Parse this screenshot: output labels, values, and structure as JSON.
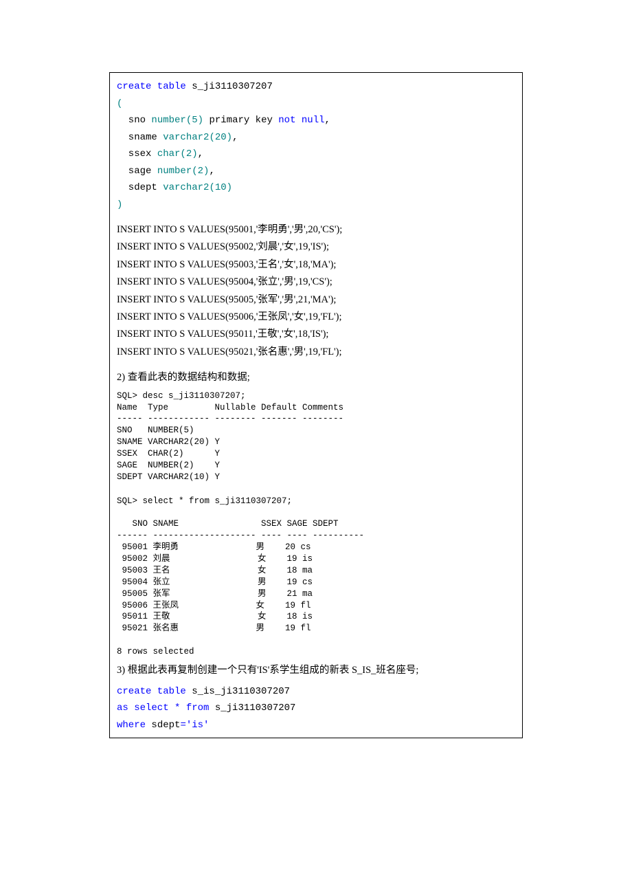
{
  "sql1": {
    "l1a": "create table",
    "l1b": " s_ji3110307207",
    "l2": "(",
    "l3a": "  sno ",
    "l3b": "number",
    "l3c": "(",
    "l3d": "5",
    "l3e": ")",
    "l3f": " primary key ",
    "l3g": "not null",
    "l3h": ",",
    "l4a": "  sname ",
    "l4b": "varchar2",
    "l4c": "(",
    "l4d": "20",
    "l4e": ")",
    "l4f": ",",
    "l5a": "  ssex ",
    "l5b": "char",
    "l5c": "(",
    "l5d": "2",
    "l5e": ")",
    "l5f": ",",
    "l6a": "  sage ",
    "l6b": "number",
    "l6c": "(",
    "l6d": "2",
    "l6e": ")",
    "l6f": ",",
    "l7a": "  sdept ",
    "l7b": "varchar2",
    "l7c": "(",
    "l7d": "10",
    "l7e": ")",
    "l8": ")"
  },
  "inserts": [
    "INSERT INTO S VALUES(95001,'李明勇','男',20,'CS');",
    "INSERT INTO S VALUES(95002,'刘晨','女',19,'IS');",
    "INSERT INTO S VALUES(95003,'王名','女',18,'MA');",
    "INSERT INTO S VALUES(95004,'张立','男',19,'CS');",
    "INSERT INTO S VALUES(95005,'张军','男',21,'MA');",
    "INSERT INTO S VALUES(95006,'王张凤','女',19,'FL');",
    "INSERT INTO S VALUES(95011,'王敬','女',18,'IS');",
    "INSERT INTO S VALUES(95021,'张名惠','男',19,'FL');"
  ],
  "task2": "2)   查看此表的数据结构和数据;",
  "desc_out": "SQL> desc s_ji3110307207;\nName  Type         Nullable Default Comments\n----- ------------ -------- ------- --------\nSNO   NUMBER(5)\nSNAME VARCHAR2(20) Y\nSSEX  CHAR(2)      Y\nSAGE  NUMBER(2)    Y\nSDEPT VARCHAR2(10) Y",
  "select_out": "SQL> select * from s_ji3110307207;\n\n   SNO SNAME                SSEX SAGE SDEPT\n------ -------------------- ---- ---- ----------\n 95001 李明勇               男    20 cs\n 95002 刘晨                 女    19 is\n 95003 王名                 女    18 ma\n 95004 张立                 男    19 cs\n 95005 张军                 男    21 ma\n 95006 王张凤               女    19 fl\n 95011 王敬                 女    18 is\n 95021 张名惠               男    19 fl\n\n8 rows selected",
  "task3": "3)   根据此表再复制创建一个只有'IS'系学生组成的新表 S_IS_班名座号;",
  "sql3": {
    "l1a": "create table",
    "l1b": " s_is_ji3110307207",
    "l2a": "as select ",
    "l2b": "*",
    "l2c": " from",
    "l2d": " s_ji3110307207",
    "l3a": "where",
    "l3b": " sdept",
    "l3c": "=",
    "l3d": "'is'"
  }
}
